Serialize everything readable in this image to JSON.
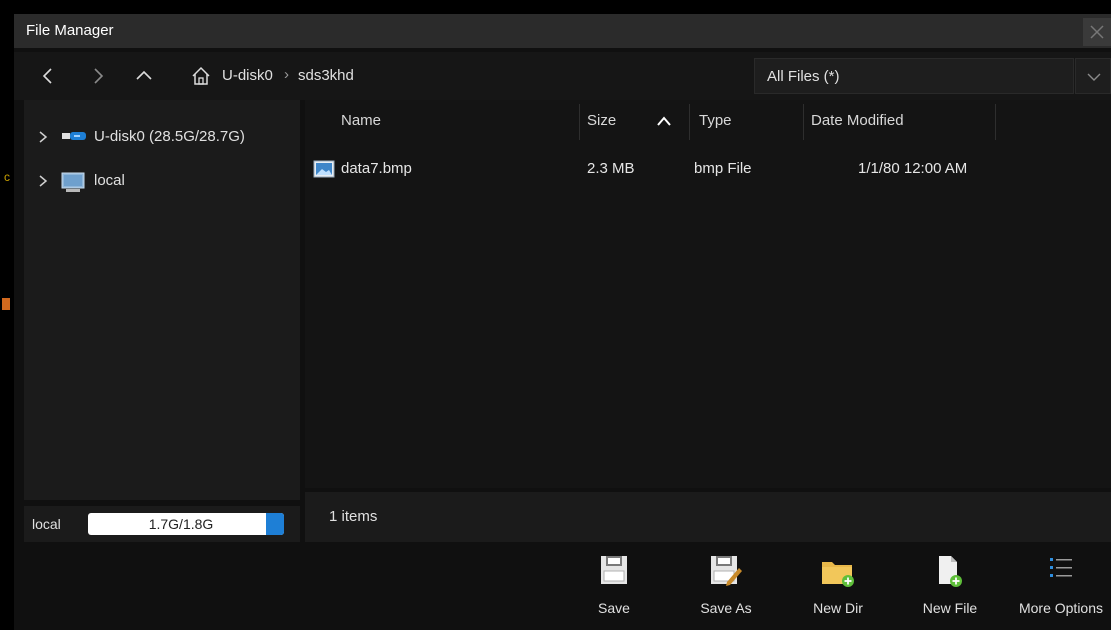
{
  "window": {
    "title": "File Manager"
  },
  "nav": {
    "crumbs": [
      "U-disk0",
      "sds3khd"
    ],
    "filter": {
      "value": "All Files (*)"
    }
  },
  "tree": {
    "items": [
      {
        "label": "U-disk0  (28.5G/28.7G)",
        "icon": "usb-drive-icon"
      },
      {
        "label": "local",
        "icon": "computer-icon"
      }
    ]
  },
  "files": {
    "columns": [
      "Name",
      "Size",
      "Type",
      "Date Modified"
    ],
    "rows": [
      {
        "name": "data7.bmp",
        "size": "2.3 MB",
        "type": "bmp File",
        "modified": "1/1/80 12:00 AM",
        "icon": "image-file-icon"
      }
    ]
  },
  "status": {
    "storage_label": "local",
    "storage_text": "1.7G/1.8G",
    "storage_used_fraction": 0.94,
    "item_count": "1 items"
  },
  "toolbar": {
    "save": "Save",
    "save_as": "Save As",
    "new_dir": "New Dir",
    "new_file": "New File",
    "more_options": "More Options"
  },
  "colors": {
    "background": "#000000",
    "panel": "#1b1b1b",
    "accent_blue": "#1e7fd6",
    "folder_yellow": "#e8b84a"
  }
}
